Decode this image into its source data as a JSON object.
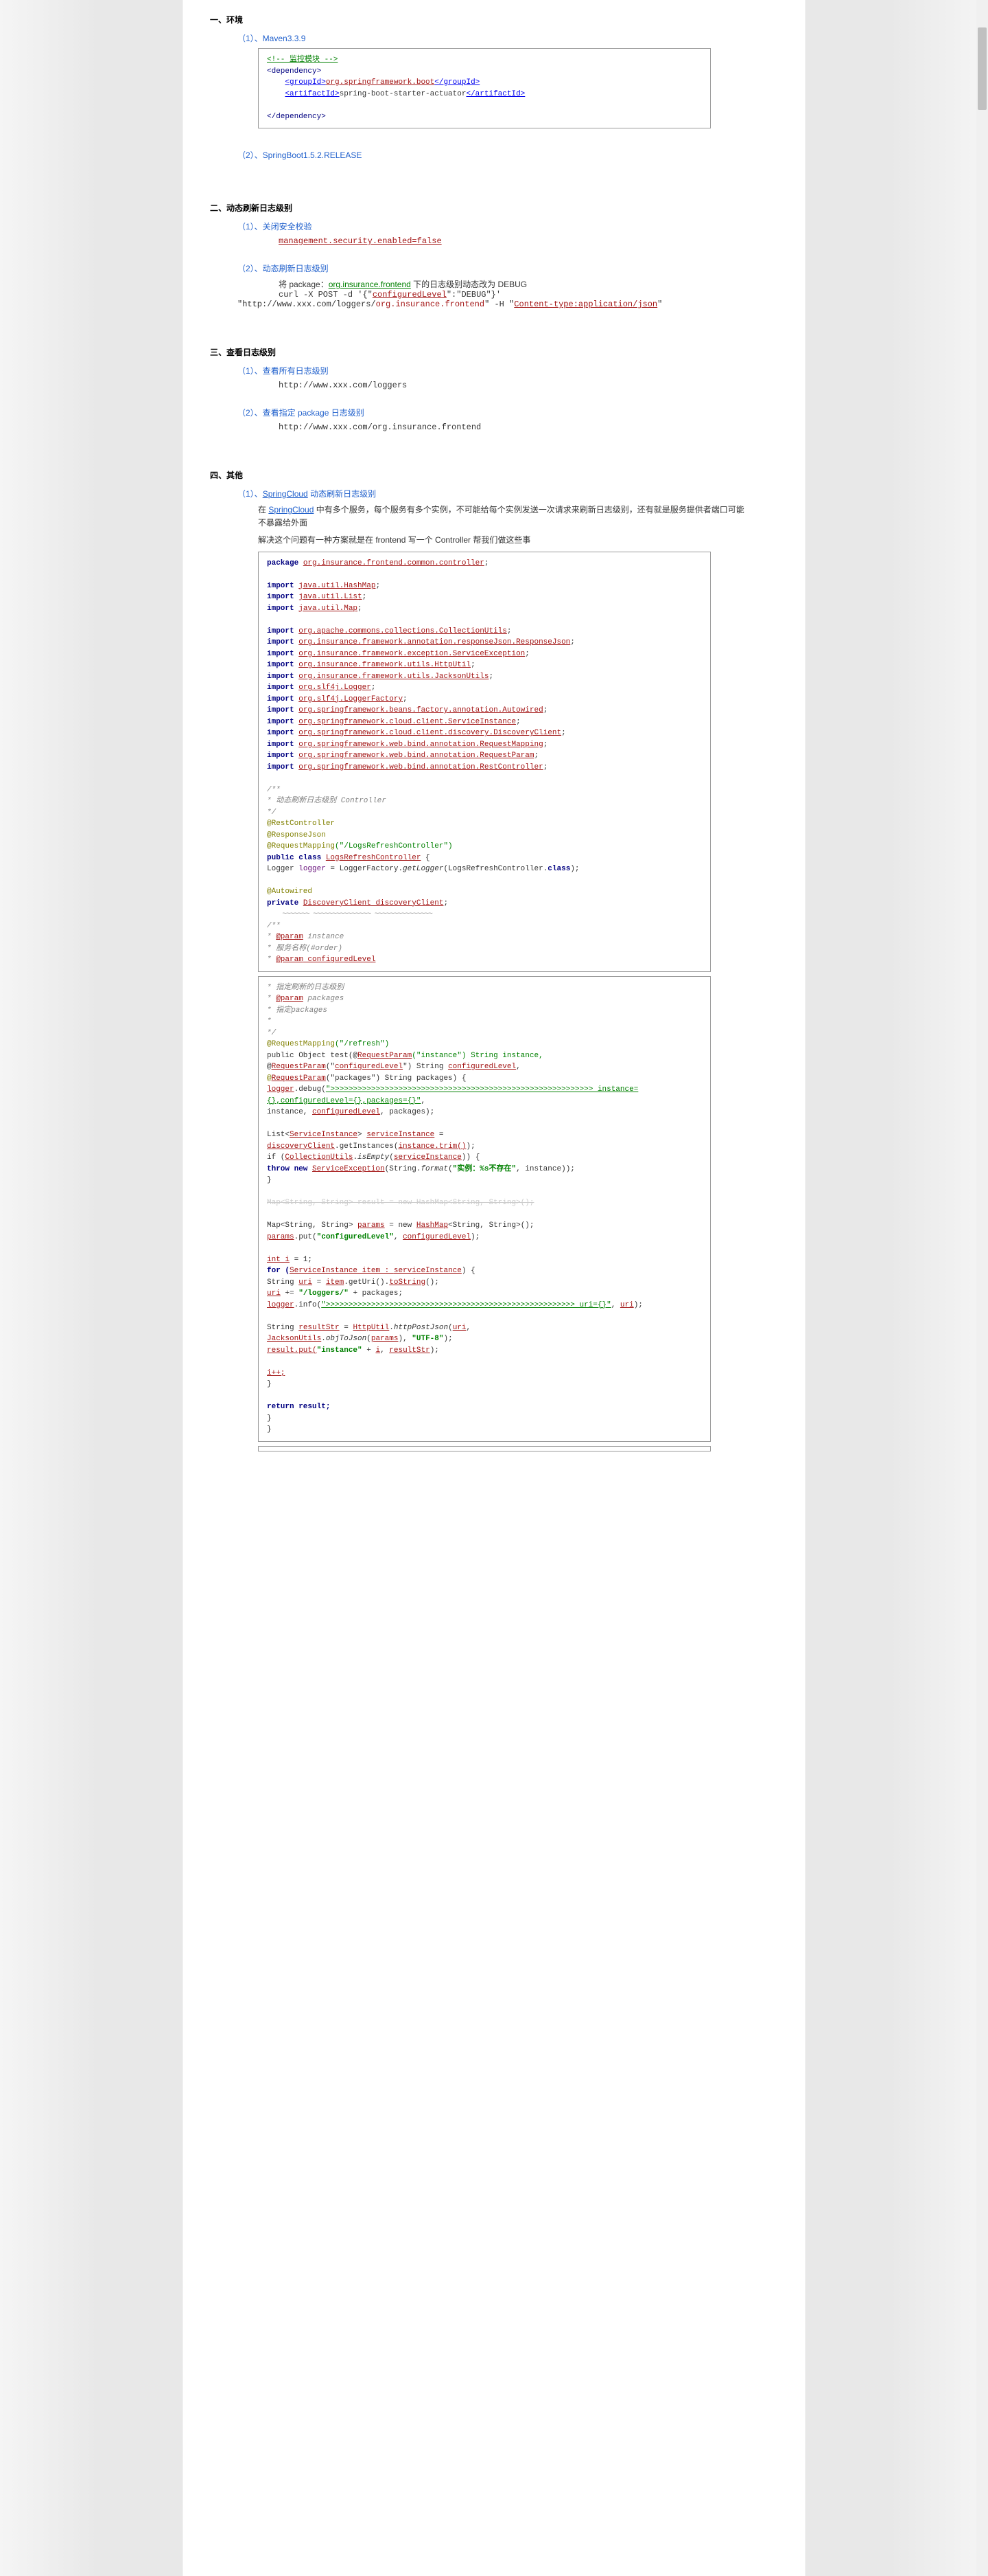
{
  "s1": {
    "title": "一、环境",
    "item1": "（1）、Maven3.3.9",
    "code": {
      "comment": "<!-- 监控模块 -->",
      "open": "<dependency>",
      "gid_open": "<groupId>",
      "gid_val": "org.springframework.boot",
      "gid_close": "</groupId>",
      "aid_open": "<artifactId>",
      "aid_val": "spring-boot-starter-actuator",
      "aid_close": "</artifactId>",
      "close": "</dependency>"
    },
    "item2": "（2）、SpringBoot1.5.2.RELEASE"
  },
  "s2": {
    "title": "二、动态刷新日志级别",
    "item1": "（1）、关闭安全校验",
    "prop": "management.security.enabled=false",
    "item2": "（2）、动态刷新日志级别",
    "sub_a": "将 package：",
    "sub_b": "org.insurance.frontend",
    "sub_c": " 下的日志级别动态改为 DEBUG",
    "curl1a": "curl -X POST -d '{\"",
    "curl1b": "configuredLevel",
    "curl1c": "\":\"DEBUG\"}'",
    "curl2a": "\"http://www.xxx.com/loggers/",
    "curl2b": "org.insurance.frontend",
    "curl2c": "\" -H \"",
    "curl2d": "Content-type:application/json",
    "curl2e": "\""
  },
  "s3": {
    "title": "三、查看日志级别",
    "item1": "（1）、查看所有日志级别",
    "url1": "http://www.xxx.com/loggers",
    "item2": "（2）、查看指定 package 日志级别",
    "url2": "http://www.xxx.com/org.insurance.frontend"
  },
  "s4": {
    "title": "四、其他",
    "item1a": "（1）、",
    "item1b": "SpringCloud",
    "item1c": " 动态刷新日志级别",
    "p1a": "在 ",
    "p1b": "SpringCloud",
    "p1c": " 中有多个服务，每个服务有多个实例，不可能给每个实例发送一次请求来刷新日志级别，还有就是服务提供者端口可能不暴露给外面",
    "p2": "解决这个问题有一种方案就是在 frontend 写一个 Controller 帮我们做这些事"
  },
  "code1": {
    "pkg_kw": "package ",
    "pkg_val": "org.insurance.frontend.common.controller",
    "imp_kw": "import ",
    "imports": [
      "java.util.HashMap",
      "java.util.List",
      "java.util.Map"
    ],
    "imports2": [
      "org.apache.commons.collections.CollectionUtils",
      "org.insurance.framework.annotation.responseJson.ResponseJson",
      "org.insurance.framework.exception.ServiceException",
      "org.insurance.framework.utils.HttpUtil",
      "org.insurance.framework.utils.JacksonUtils",
      "org.slf4j.Logger",
      "org.slf4j.LoggerFactory",
      "org.springframework.beans.factory.annotation.Autowired",
      "org.springframework.cloud.client.ServiceInstance",
      "org.springframework.cloud.client.discovery.DiscoveryClient",
      "org.springframework.web.bind.annotation.RequestMapping",
      "org.springframework.web.bind.annotation.RequestParam",
      "org.springframework.web.bind.annotation.RestController"
    ],
    "jd1": "/**",
    "jd2": " * 动态刷新日志级别 Controller",
    "jd3": " */",
    "a1": "@RestController",
    "a2": "@ResponseJson",
    "a3a": "@RequestMapping",
    "a3b": "(\"/LogsRefreshController\")",
    "cls_a": "public class ",
    "cls_b": "LogsRefreshController",
    "cls_c": " {",
    "log_a": "    Logger ",
    "log_b": "logger",
    "log_c": " = LoggerFactory.",
    "log_d": "getLogger",
    "log_e": "(LogsRefreshController.",
    "log_f": "class",
    "log_g": ");",
    "aw": "    @Autowired",
    "dc_a": "    private ",
    "dc_b": "DiscoveryClient",
    "dc_c": " discoveryClient",
    "mjd1": "    /**",
    "mjd2": "     * ",
    "mjd2b": "@param",
    "mjd2c": " instance",
    "mjd3": "     *            服务名称(#order)",
    "mjd4": "     * ",
    "mjd4b": "@param",
    "mjd4c": " configuredLevel"
  },
  "code2": {
    "jd1": "     *            指定刷新的日志级别",
    "jd2a": "     * ",
    "jd2b": "@param",
    "jd2c": " packages",
    "jd3": "     *            指定packages",
    "jd4": "     *",
    "jd5": "     */",
    "rm_a": "    @RequestMapping",
    "rm_b": "(\"/refresh\")",
    "sig_a": "    public Object test(@",
    "sig_b": "RequestParam",
    "sig_c": "(\"instance\") String instance,",
    "sig2_a": "            @",
    "sig2_b": "RequestParam",
    "sig2_c": "(\"",
    "sig2_d": "configuredLevel",
    "sig2_e": "\") String ",
    "sig2_f": "configuredLevel",
    "sig2_g": ",",
    "sig3_a": "@",
    "sig3_b": "RequestParam",
    "sig3_c": "(\"packages\") String packages) {",
    "dbg_a": "        logger",
    "dbg_b": ".debug(",
    "dbg_s": "\">>>>>>>>>>>>>>>>>>>>>>>>>>>>>>>>>>>>>>>>>>>>>>>>>>>>>>>>>> instance={},configuredLevel={},packages={}\"",
    "dbg_e": ",",
    "dbg2": "                instance, ",
    "dbg2b": "configuredLevel",
    "dbg2c": ", packages);",
    "lst_a": "        List<",
    "lst_b": "ServiceInstance",
    "lst_c": "> ",
    "lst_d": "serviceInstance",
    "lst_e": " = ",
    "lst2_a": "discoveryClient",
    "lst2_b": ".getInstances(",
    "lst2_c": "instance.trim()",
    "lst2_d": ");",
    "if_a": "        if (",
    "if_b": "CollectionUtils",
    "if_c": ".",
    "if_d": "isEmpty",
    "if_e": "(",
    "if_f": "serviceInstance",
    "if_g": ")) {",
    "thr_a": "            throw new ",
    "thr_b": "ServiceException",
    "thr_c": "(String.",
    "thr_d": "format",
    "thr_e": "(",
    "thr_f": "\"实例：%s不存在\"",
    "thr_g": ", instance));",
    "cb": "        }",
    "map0": "        Map<String, String> result = new HashMap<String, String>();",
    "map_a": "        Map<String, String> ",
    "map_b": "params",
    "map_c": " = new ",
    "map_d": "HashMap",
    "map_e": "<String, String>();",
    "put_a": "        params",
    "put_b": ".put(",
    "put_c": "\"configuredLevel\"",
    "put_d": ", ",
    "put_e": "configuredLevel",
    "put_f": ");",
    "int_a": "        int ",
    "int_b": "i",
    "int_c": " = 1;",
    "for_a": "        for (",
    "for_b": "ServiceInstance",
    "for_c": " item : ",
    "for_d": "serviceInstance",
    "for_e": ") {",
    "uri_a": "            String ",
    "uri_b": "uri",
    "uri_c": " = ",
    "uri_d": "item",
    "uri_e": ".getUri().",
    "uri_f": "toString",
    "uri_g": "();",
    "ur2_a": "            uri",
    "ur2_b": " += ",
    "ur2_c": "\"/loggers/\"",
    "ur2_d": " + packages;",
    "inf_a": "            logger",
    "inf_b": ".info(",
    "inf_c": "\">>>>>>>>>>>>>>>>>>>>>>>>>>>>>>>>>>>>>>>>>>>>>>>>>>>>>>> uri={}\"",
    "inf_d": ", ",
    "inf_e": "uri",
    "inf_f": ");",
    "rs_a": "            String ",
    "rs_b": "resultStr",
    "rs_c": " = ",
    "rs_d": "HttpUtil",
    "rs_e": ".",
    "rs_f": "httpPostJson",
    "rs_g": "(",
    "rs_h": "uri",
    "rs_i": ", ",
    "rs2_a": "JacksonUtils",
    "rs2_b": ".",
    "rs2_c": "objToJson",
    "rs2_d": "(",
    "rs2_e": "params",
    "rs2_f": "), ",
    "rs2_g": "\"UTF-8\"",
    "rs2_h": ");",
    "rp_a": "            result.put(",
    "rp_b": "\"instance\"",
    "rp_c": " + ",
    "rp_d": "i",
    "rp_e": ", ",
    "rp_f": "resultStr",
    "rp_g": ");",
    "inc": "            i++;",
    "cb2": "        }",
    "ret": "        return result;",
    "cb3": "    }",
    "cb4": "}"
  }
}
